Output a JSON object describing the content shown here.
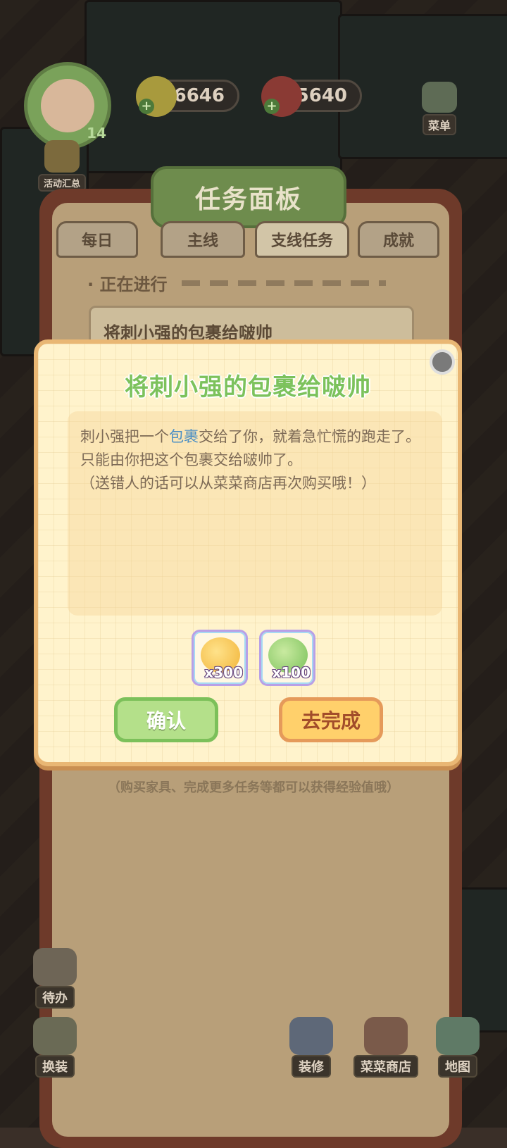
{
  "hud": {
    "level": "14",
    "coins": "36646",
    "gems": "5640",
    "menu_label": "菜单",
    "events_label": "活动汇总"
  },
  "panel": {
    "title": "任务面板",
    "tabs": [
      "每日",
      "主线",
      "支线任务",
      "成就"
    ],
    "active_tab": "支线任务",
    "section_label": "· 正在进行",
    "task_title": "将刺小强的包裹给啵帅",
    "hint": "（购买家具、完成更多任务等都可以获得经验值哦）"
  },
  "dialog": {
    "title": "将刺小强的包裹给啵帅",
    "desc_part1": "刺小强把一个",
    "desc_keyword": "包裹",
    "desc_part2": "交给了你，就着急忙慌的跑走了。只能由你把这个包裹交给啵帅了。",
    "desc_note": "（送错人的话可以从菜菜商店再次购买哦！）",
    "rewards": [
      {
        "icon": "gold-coins-icon",
        "qty": "x300"
      },
      {
        "icon": "exp-up-icon",
        "qty": "x100"
      }
    ],
    "confirm_label": "确认",
    "go_label": "去完成"
  },
  "bottom": {
    "todo_label": "待办",
    "dress_label": "换装",
    "decorate_label": "装修",
    "shop_label": "菜菜商店",
    "map_label": "地图"
  },
  "colors": {
    "title_green": "#7cc25c",
    "keyword_blue": "#4a8ec4",
    "confirm_bg": "#b4e08a",
    "go_bg": "#ffd06b"
  }
}
